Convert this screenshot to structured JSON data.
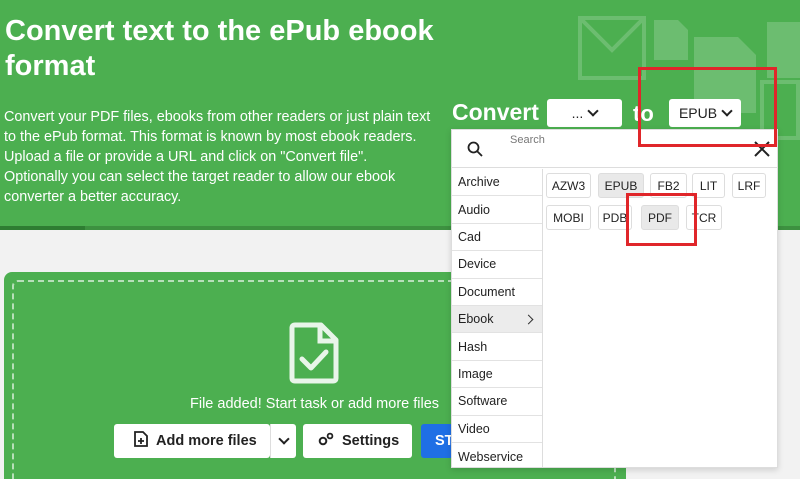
{
  "hero": {
    "title": "Convert text to the ePub ebook format",
    "description": "Convert your PDF files, ebooks from other readers or just plain text to the ePub format. This format is known by most ebook readers. Upload a file or provide a URL and click on \"Convert file\". Optionally you can select the target reader to allow our ebook converter a better accuracy."
  },
  "converter": {
    "convert_label": "Convert",
    "from_value": "...",
    "to_label": "to",
    "to_value": "EPUB"
  },
  "dropdown": {
    "search_placeholder": "Search",
    "categories": [
      "Archive",
      "Audio",
      "Cad",
      "Device",
      "Document",
      "Ebook",
      "Hash",
      "Image",
      "Software",
      "Video",
      "Webservice"
    ],
    "active_category": "Ebook",
    "formats": [
      "AZW3",
      "EPUB",
      "FB2",
      "LIT",
      "LRF",
      "MOBI",
      "PDB",
      "PDF",
      "TCR"
    ],
    "selected_format": "EPUB",
    "highlighted_format": "PDF"
  },
  "upload": {
    "status_text": "File added! Start task or add more files",
    "add_more_label": "Add more files",
    "settings_label": "Settings",
    "start_label": "ST"
  },
  "colors": {
    "brand_green": "#4caf50",
    "highlight_red": "#e0262a",
    "start_blue": "#1f6fe5"
  }
}
